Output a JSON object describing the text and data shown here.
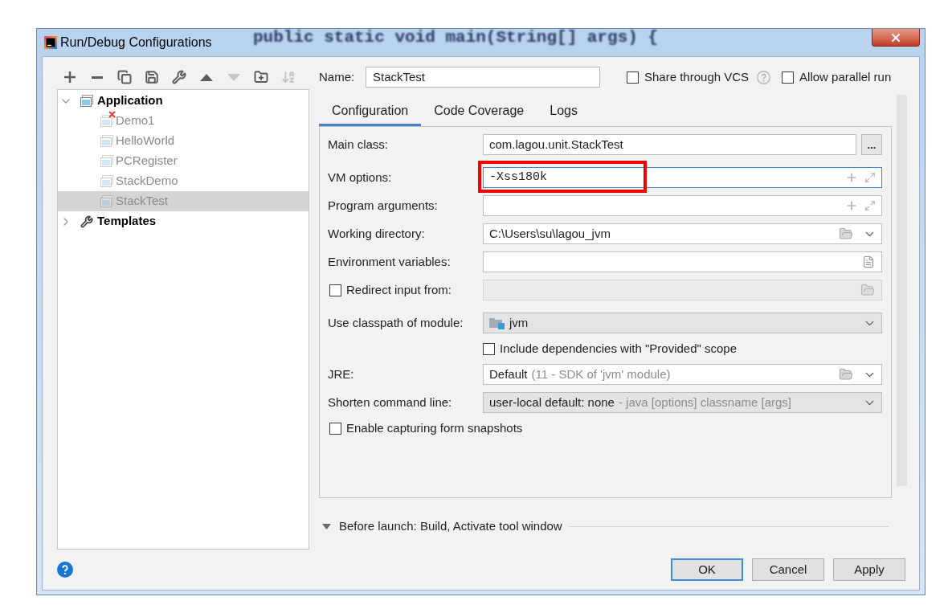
{
  "window": {
    "title": "Run/Debug Configurations",
    "background_code": "public static void main(String[] args) {"
  },
  "toolbar": [
    {
      "kind": "add",
      "disabled": false
    },
    {
      "kind": "remove",
      "disabled": false
    },
    {
      "kind": "copy",
      "disabled": false
    },
    {
      "kind": "save",
      "disabled": false
    },
    {
      "kind": "edit",
      "disabled": false
    },
    {
      "kind": "up",
      "disabled": false
    },
    {
      "kind": "down",
      "disabled": true
    },
    {
      "kind": "folder",
      "disabled": false
    },
    {
      "kind": "sort",
      "disabled": true
    }
  ],
  "tree": [
    {
      "label": "Application",
      "kind": "application",
      "expanded": true,
      "selected": false,
      "children": [
        {
          "label": "Demo1",
          "dimmed": true,
          "error": true,
          "selected": false
        },
        {
          "label": "HelloWorld",
          "dimmed": true,
          "error": false,
          "selected": false
        },
        {
          "label": "PCRegister",
          "dimmed": true,
          "error": false,
          "selected": false
        },
        {
          "label": "StackDemo",
          "dimmed": true,
          "error": false,
          "selected": false
        },
        {
          "label": "StackTest",
          "dimmed": true,
          "error": false,
          "selected": true
        }
      ]
    },
    {
      "label": "Templates",
      "kind": "templates",
      "expanded": false,
      "selected": false
    }
  ],
  "name": {
    "label": "Name:",
    "value": "StackTest"
  },
  "options": [
    {
      "label": "Share through VCS",
      "checked": false,
      "help": true
    },
    {
      "label": "Allow parallel run",
      "checked": false
    }
  ],
  "tabs": [
    {
      "label": "Configuration",
      "selected": true
    },
    {
      "label": "Code Coverage",
      "selected": false
    },
    {
      "label": "Logs",
      "selected": false
    }
  ],
  "form": [
    {
      "kind": "text",
      "label": "Main class:",
      "value": "com.lagou.unit.StackTest",
      "button": "..."
    },
    {
      "kind": "expandable",
      "label": "VM options:",
      "value": "-Xss180k",
      "focused": true,
      "highlighted": true
    },
    {
      "kind": "expandable",
      "label": "Program arguments:",
      "focused": false,
      "highlighted": false
    },
    {
      "kind": "path",
      "label": "Working directory:",
      "value": "C:\\Users\\su\\lagou_jvm"
    },
    {
      "kind": "env",
      "label": "Environment variables:"
    },
    {
      "kind": "check_field",
      "label": "Redirect input from:",
      "checked": false,
      "disabled": true
    },
    {
      "kind": "module",
      "label": "Use classpath of module:",
      "value": "jvm"
    },
    {
      "kind": "sub_checkbox",
      "label": "Include dependencies with \"Provided\" scope",
      "checked": false
    },
    {
      "kind": "jre",
      "label": "JRE:",
      "value": "Default",
      "hint": "(11 - SDK of 'jvm' module)"
    },
    {
      "kind": "combo",
      "label": "Shorten command line:",
      "value": "user-local default: none",
      "hint": "- java [options] classname [args]"
    },
    {
      "kind": "checkbox",
      "label": "Enable capturing form snapshots",
      "checked": false
    }
  ],
  "before_launch": {
    "label": "Before launch: Build, Activate tool window"
  },
  "buttons": [
    {
      "label": "OK",
      "default": true
    },
    {
      "label": "Cancel",
      "default": false
    },
    {
      "label": "Apply",
      "default": false
    }
  ]
}
